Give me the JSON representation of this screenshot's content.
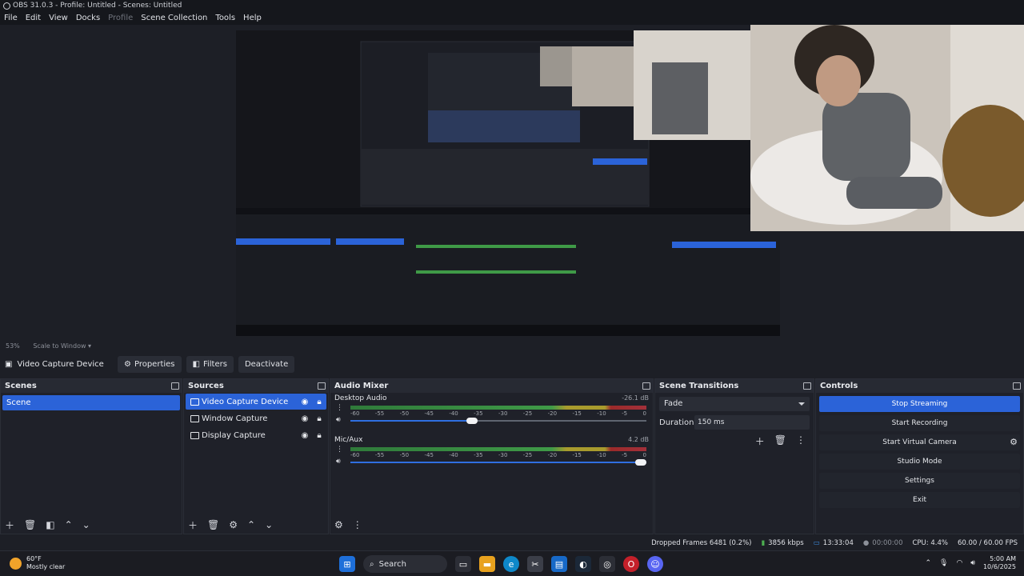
{
  "window": {
    "title": "OBS 31.0.3 - Profile: Untitled - Scenes: Untitled"
  },
  "menu": [
    {
      "label": "File",
      "enabled": true
    },
    {
      "label": "Edit",
      "enabled": true
    },
    {
      "label": "View",
      "enabled": true
    },
    {
      "label": "Docks",
      "enabled": true
    },
    {
      "label": "Profile",
      "enabled": false
    },
    {
      "label": "Scene Collection",
      "enabled": true
    },
    {
      "label": "Tools",
      "enabled": true
    },
    {
      "label": "Help",
      "enabled": true
    }
  ],
  "preview": {
    "zoom": "53%",
    "scale_label": "Scale to Window"
  },
  "source_toolbar": {
    "source_name": "Video Capture Device",
    "properties": "Properties",
    "filters": "Filters",
    "deactivate": "Deactivate"
  },
  "scenes": {
    "title": "Scenes",
    "items": [
      "Scene"
    ]
  },
  "sources": {
    "title": "Sources",
    "items": [
      {
        "name": "Video Capture Device",
        "selected": true
      },
      {
        "name": "Window Capture",
        "selected": false
      },
      {
        "name": "Display Capture",
        "selected": false
      }
    ]
  },
  "mixer": {
    "title": "Audio Mixer",
    "ticks": [
      "-60",
      "-55",
      "-50",
      "-45",
      "-40",
      "-35",
      "-30",
      "-25",
      "-20",
      "-15",
      "-10",
      "-5",
      "0"
    ],
    "channels": [
      {
        "name": "Desktop Audio",
        "db": "-26.1 dB",
        "volume_fraction": 0.41
      },
      {
        "name": "Mic/Aux",
        "db": "4.2 dB",
        "volume_fraction": 1.0
      }
    ]
  },
  "transitions": {
    "title": "Scene Transitions",
    "selected": "Fade",
    "duration_label": "Duration",
    "duration_value": "150 ms"
  },
  "controls": {
    "title": "Controls",
    "stop_streaming": "Stop Streaming",
    "start_recording": "Start Recording",
    "start_virtual_camera": "Start Virtual Camera",
    "studio_mode": "Studio Mode",
    "settings": "Settings",
    "exit": "Exit"
  },
  "status": {
    "dropped_frames": "Dropped Frames 6481 (0.2%)",
    "bitrate": "3856 kbps",
    "stream_time": "13:33:04",
    "record_time": "00:00:00",
    "cpu": "CPU: 4.4%",
    "fps": "60.00 / 60.00 FPS"
  },
  "taskbar": {
    "temperature": "60°F",
    "weather": "Mostly clear",
    "search_label": "Search",
    "time": "5:00 AM",
    "date": "10/6/2025"
  },
  "colors": {
    "accent": "#2b63d8",
    "panel": "#1f2129",
    "background": "#1d1f26"
  }
}
